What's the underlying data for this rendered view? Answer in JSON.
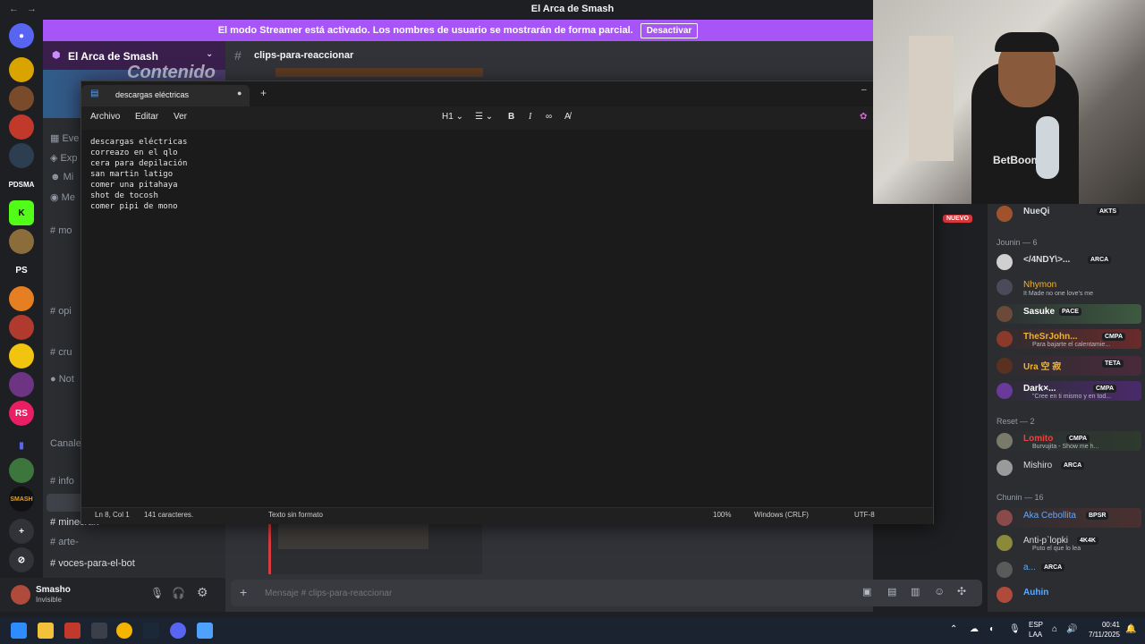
{
  "window": {
    "title": "El Arca de Smash"
  },
  "banner": {
    "text": "El modo Streamer está activado. Los nombres de usuario se mostrarán de forma parcial.",
    "button": "Desactivar"
  },
  "server": {
    "name": "El Arca de Smash",
    "header_art_text": "Contenido"
  },
  "channel": {
    "title": "clips-para-reaccionar"
  },
  "sidebar": {
    "rows": [
      "Eve",
      "Exp",
      "Mi",
      "Me",
      "mo",
      "opi",
      "cru",
      "Not",
      "Canales",
      "info",
      "minecraft",
      "arte-",
      "voces-para-el-bot"
    ]
  },
  "user": {
    "name": "Smasho",
    "status": "Invisible"
  },
  "message_bar": {
    "placeholder": "Mensaje # clips-para-reaccionar"
  },
  "new_badge": "NUEVO",
  "notepad": {
    "tab_title": "descargas eléctricas",
    "menu": [
      "Archivo",
      "Editar",
      "Ver"
    ],
    "heading_btn": "H1",
    "content": "descargas eléctricas\ncorreazo en el qlo\ncera para depilación\nsan martin latigo\ncomer una pitahaya\nshot de tocosh\ncomer pipi de mono",
    "status": {
      "position": "Ln 8, Col 1",
      "chars": "141 caracteres.",
      "format": "Texto sin formato",
      "zoom": "100%",
      "eol": "Windows (CRLF)",
      "encoding": "UTF-8"
    }
  },
  "webcam": {
    "shirt_text": "BetBoom"
  },
  "members": {
    "top": {
      "name": "NueQi",
      "tag": "AKTS"
    },
    "sections": [
      {
        "title": "Jounin — 6"
      },
      {
        "title": "Reset — 2"
      },
      {
        "title": "Chunin — 16"
      }
    ],
    "jounin": [
      {
        "name": "</4NDY\\>...",
        "tag": "ARCA",
        "sub": "",
        "color": "#dbdee1"
      },
      {
        "name": "Nhymon",
        "tag": "",
        "sub": "It Made no one love's me",
        "color": "#f0b232"
      },
      {
        "name": "Sasuke",
        "tag": "PACE",
        "sub": "",
        "color": "#ffffff"
      },
      {
        "name": "TheSrJohn...",
        "tag": "CMPA",
        "sub": "Para bajarte el calentamie...",
        "color": "#f0b232"
      },
      {
        "name": "Ura 空 寂",
        "tag": "TETA",
        "sub": "",
        "color": "#f0b232"
      },
      {
        "name": "Dark×...",
        "tag": "CMPA",
        "sub": "\"Cree en ti mismo y en tod...",
        "color": "#ffffff"
      }
    ],
    "reset": [
      {
        "name": "Lomito",
        "tag": "CMPA",
        "sub": "Burvujita - Show me h...",
        "color": "#f23f42"
      },
      {
        "name": "Mishiro",
        "tag": "ARCA",
        "sub": "",
        "color": "#dbdee1"
      }
    ],
    "chunin": [
      {
        "name": "Aka Cebollita",
        "tag": "BPSR",
        "sub": "",
        "color": "#5fa8ff"
      },
      {
        "name": "Anti-p`lopki",
        "tag": "4K4K",
        "sub": "Puto el que lo lea",
        "color": "#dbdee1"
      },
      {
        "name": "a...",
        "tag": "ARCA",
        "sub": "",
        "color": "#5fa8ff"
      },
      {
        "name": "Auhin",
        "tag": "",
        "sub": "",
        "color": "#5fa8ff"
      }
    ]
  },
  "taskbar": {
    "lang": "ESP",
    "lang2": "LAA",
    "time": "00:41",
    "date": "7/11/2025"
  },
  "colors": {
    "banner": "#a855f7",
    "accent": "#5865f2"
  }
}
